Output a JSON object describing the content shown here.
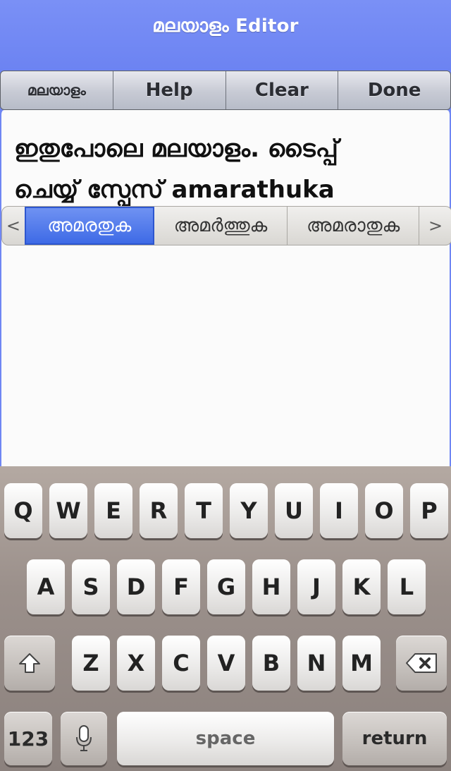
{
  "header": {
    "title": "മലയാളം Editor"
  },
  "toolbar": {
    "lang_label": "മലയാളം",
    "help_label": "Help",
    "clear_label": "Clear",
    "done_label": "Done"
  },
  "editor": {
    "text": "ഇതുപോലെ മലയാളം. ടൈപ്പ്\nചെയ്യ് സ്പേസ് amarathuka"
  },
  "suggestions": {
    "prev": "<",
    "next": ">",
    "items": [
      "അമരതുക",
      "അമർത്തുക",
      "അമരാതുക"
    ]
  },
  "keyboard": {
    "row1": [
      "Q",
      "W",
      "E",
      "R",
      "T",
      "Y",
      "U",
      "I",
      "O",
      "P"
    ],
    "row2": [
      "A",
      "S",
      "D",
      "F",
      "G",
      "H",
      "J",
      "K",
      "L"
    ],
    "row3": [
      "Z",
      "X",
      "C",
      "V",
      "B",
      "N",
      "M"
    ],
    "numbers_label": "123",
    "space_label": "space",
    "return_label": "return",
    "shift_icon": "shift-arrow-icon",
    "backspace_icon": "backspace-icon",
    "mic_icon": "microphone-icon"
  },
  "colors": {
    "accent": "#6f86f3",
    "selected_suggestion": "#3e6ae6"
  }
}
